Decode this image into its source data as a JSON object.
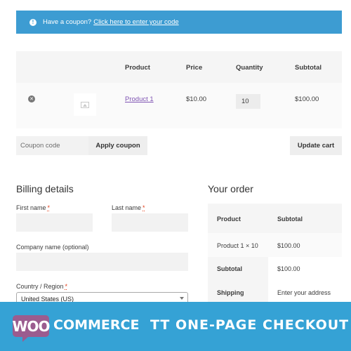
{
  "notice": {
    "text": "Have a coupon?",
    "link": "Click here to enter your code"
  },
  "cart": {
    "headers": [
      "Product",
      "Price",
      "Quantity",
      "Subtotal"
    ],
    "rows": [
      {
        "product": "Product 1",
        "price": "$10.00",
        "quantity": "10",
        "subtotal": "$100.00"
      }
    ]
  },
  "coupon": {
    "placeholder": "Coupon code",
    "apply_label": "Apply coupon",
    "update_label": "Update cart"
  },
  "billing": {
    "title": "Billing details",
    "first_name_label": "First name",
    "last_name_label": "Last name",
    "company_label": "Company name (optional)",
    "country_label": "Country / Region",
    "country_value": "United States (US)",
    "required_mark": "*"
  },
  "order": {
    "title": "Your order",
    "head_product": "Product",
    "head_subtotal": "Subtotal",
    "item_name": "Product 1  × 10",
    "item_total": "$100.00",
    "subtotal_label": "Subtotal",
    "subtotal_value": "$100.00",
    "shipping_label": "Shipping",
    "shipping_value": "Enter your address"
  },
  "banner": {
    "woo": "WOO",
    "commerce": "COMMERCE",
    "product_title": "TT ONE-PAGE CHECKOUT"
  },
  "colors": {
    "notice_blue": "#3d9cd2",
    "woo_purple": "#9b5c8f",
    "banner_blue": "#35a2d5",
    "link_purple": "#7f54b3"
  }
}
